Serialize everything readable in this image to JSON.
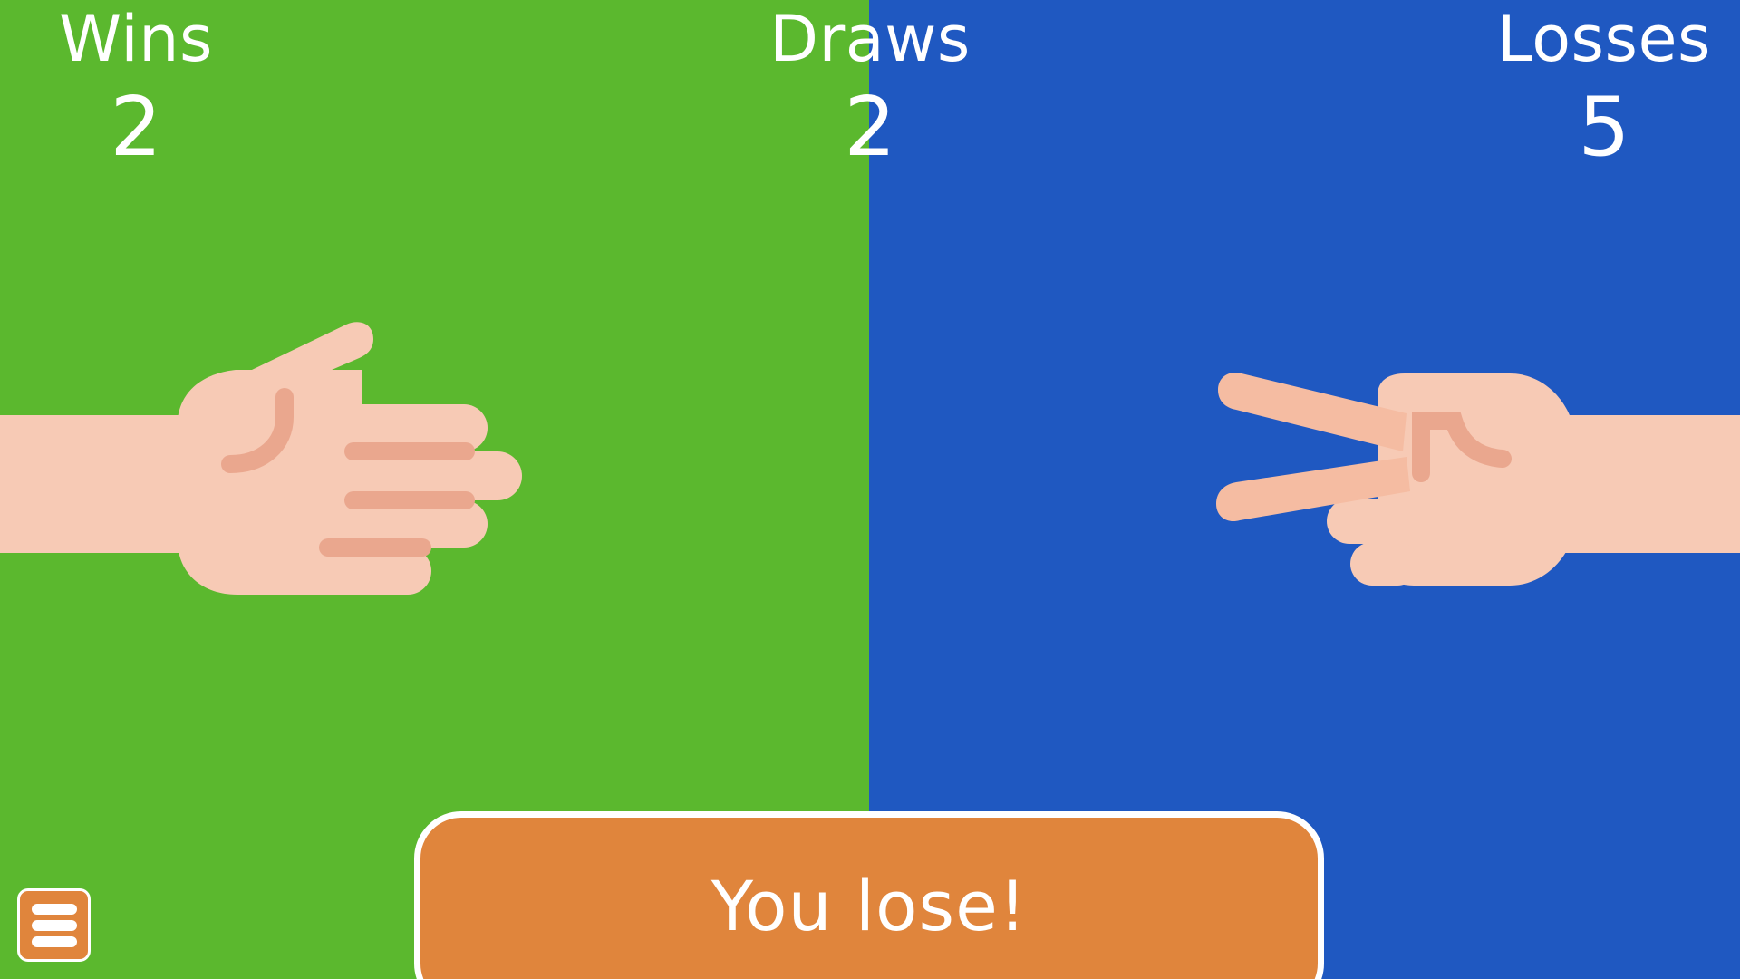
{
  "colors": {
    "player_side": "#5bb82e",
    "cpu_side": "#1f58c1",
    "banner": "#e0853c",
    "skin": "#f7cab5",
    "skin_shadow": "#eaa78e",
    "cpu_skin": "#f5bca2",
    "text": "#ffffff"
  },
  "scoreboard": {
    "wins_label": "Wins",
    "wins_value": "2",
    "draws_label": "Draws",
    "draws_value": "2",
    "losses_label": "Losses",
    "losses_value": "5"
  },
  "player_hand": {
    "gesture": "paper",
    "icon": "paper-hand-icon"
  },
  "cpu_hand": {
    "gesture": "scissors",
    "icon": "scissors-hand-icon"
  },
  "result": {
    "text": "You lose!"
  },
  "menu": {
    "icon": "hamburger-menu-icon"
  }
}
